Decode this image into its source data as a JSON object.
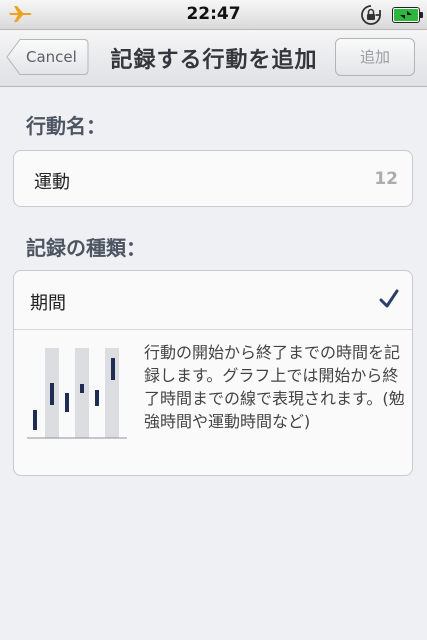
{
  "status_bar": {
    "time": "22:47",
    "icons": [
      "airplane-icon",
      "rotation-lock-icon",
      "battery-charging-icon"
    ]
  },
  "nav": {
    "cancel_label": "Cancel",
    "title": "記録する行動を追加",
    "add_label": "追加"
  },
  "name_section": {
    "label": "行動名：",
    "value": "運動",
    "remaining_chars": "12"
  },
  "type_section": {
    "label": "記録の種類：",
    "selected": "期間",
    "description": "行動の開始から終了までの時間を記録します。グラフ上では開始から終了時間までの線で表現されます。(勉強時間や運動時間など)"
  },
  "colors": {
    "accent": "#2d3e6a",
    "background": "#eff0f3",
    "airplane": "#f0a21c",
    "battery": "#2db83d"
  }
}
